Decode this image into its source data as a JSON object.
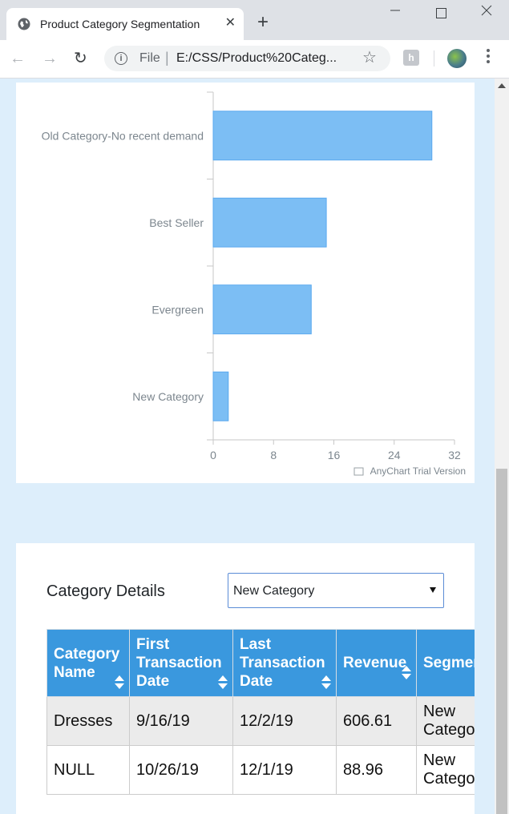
{
  "browser": {
    "tab_title": "Product Category Segmentation",
    "new_tab_glyph": "+",
    "close_tab_glyph": "✕",
    "url_scheme": "File",
    "url": "E:/CSS/Product%20Categ...",
    "ext_badge": "h"
  },
  "chart_data": {
    "type": "bar",
    "orientation": "horizontal",
    "categories": [
      "Old Category-No recent demand",
      "Best Seller",
      "Evergreen",
      "New Category"
    ],
    "values": [
      29,
      15,
      13,
      2
    ],
    "xlim": [
      0,
      32
    ],
    "ticks": [
      0,
      8,
      16,
      24,
      32
    ],
    "bar_color": "#7cbef4",
    "bar_stroke": "#5aa9ef",
    "grid": false,
    "credit": "AnyChart Trial Version"
  },
  "details": {
    "title": "Category Details",
    "select_value": "New Category",
    "columns": [
      [
        "Category",
        "Name"
      ],
      [
        "First",
        "Transaction",
        "Date"
      ],
      [
        "Last",
        "Transaction",
        "Date"
      ],
      [
        "Revenue"
      ],
      [
        "Segment"
      ]
    ],
    "rows": [
      [
        "Dresses",
        "9/16/19",
        "12/2/19",
        "606.61",
        [
          "New",
          "Category"
        ]
      ],
      [
        "NULL",
        "10/26/19",
        "12/1/19",
        "88.96",
        [
          "New",
          "Category"
        ]
      ]
    ]
  },
  "colors": {
    "header_blue": "#3a98de",
    "page_bg": "#ddeefb"
  }
}
